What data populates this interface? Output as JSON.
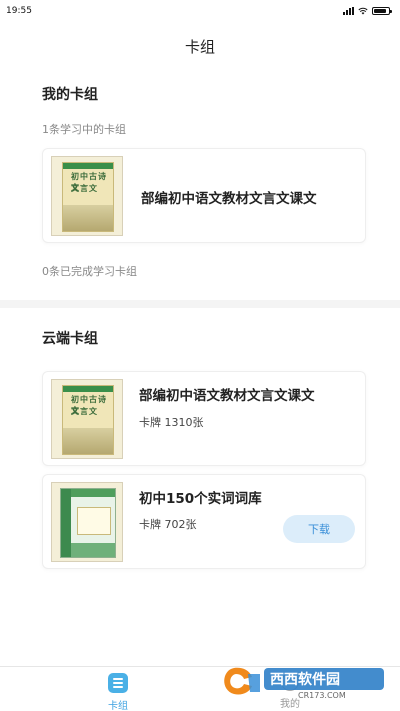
{
  "status_bar": {
    "time": "19:55",
    "battery_level": 0.85
  },
  "header": {
    "title": "卡组"
  },
  "my_decks": {
    "title": "我的卡组",
    "learning_count_text": "1条学习中的卡组",
    "learning_items": [
      {
        "title": "部编初中语文教材文言文课文"
      }
    ],
    "completed_count_text": "0条已完成学习卡组"
  },
  "cloud_decks": {
    "title": "云端卡组",
    "items": [
      {
        "title": "部编初中语文教材文言文课文",
        "meta": "卡牌  1310张"
      },
      {
        "title": "初中150个实词词库",
        "meta": "卡牌  702张",
        "action_label": "下载"
      }
    ]
  },
  "cover_text": {
    "line1": "初中古诗文",
    "line2": "文言文"
  },
  "tabbar": {
    "tabs": [
      {
        "label": "卡组",
        "active": true
      },
      {
        "label": "我的",
        "active": false
      }
    ]
  },
  "watermark": {
    "brand": "西西软件园",
    "site": "CR173.COM"
  },
  "colors": {
    "accent": "#3aa0e0",
    "button_bg": "#dcedfa",
    "tab_icon": "#4ab0e6"
  }
}
